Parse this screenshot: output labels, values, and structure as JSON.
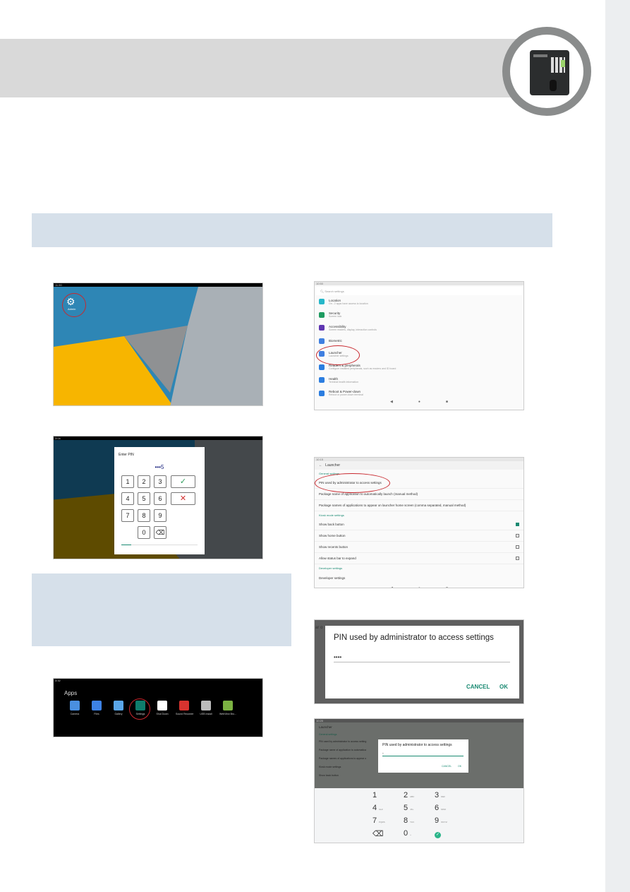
{
  "colors": {
    "header_band": "#d9d9d9",
    "info_band": "#d6e0ea",
    "ring": "#8a8c8c",
    "accent_green": "#1a8a72",
    "highlight_red": "#c8282e"
  },
  "desktop": {
    "time": "11:50",
    "icon_label": "Admin"
  },
  "pin_dialog": {
    "time": "3:04",
    "title": "Enter PIN",
    "value": "•••5",
    "keys": [
      "1",
      "2",
      "3",
      "4",
      "5",
      "6",
      "7",
      "8",
      "9",
      "0"
    ],
    "confirm_icon": "check-icon",
    "cancel_icon": "x-icon",
    "backspace_icon": "backspace-icon"
  },
  "apps": {
    "time": "3:32",
    "title": "Apps",
    "items": [
      {
        "label": "Camera",
        "color": "#4a8fe0"
      },
      {
        "label": "Files",
        "color": "#3d82e6"
      },
      {
        "label": "Gallery",
        "color": "#5aa6e8"
      },
      {
        "label": "Settings",
        "color": "#0f7d6c"
      },
      {
        "label": "Shut Down",
        "color": "#ffffff"
      },
      {
        "label": "Sound Recorder",
        "color": "#d8332f"
      },
      {
        "label": "USB Install",
        "color": "#bcbcbc"
      },
      {
        "label": "WebView Bro...",
        "color": "#7cb342"
      }
    ]
  },
  "settings": {
    "time": "10:50",
    "search_placeholder": "Search settings",
    "items": [
      {
        "title": "Location",
        "sub": "On - 2 apps have access to location",
        "color": "#26b7c9"
      },
      {
        "title": "Security",
        "sub": "Screen lock",
        "color": "#1e9c61"
      },
      {
        "title": "Accessibility",
        "sub": "Screen readers, display, interaction controls",
        "color": "#5e35b1"
      },
      {
        "title": "Biometric",
        "sub": "",
        "color": "#3f7fe0"
      },
      {
        "title": "Launcher",
        "sub": "Launcher settings",
        "color": "#3f7fe0"
      },
      {
        "title": "Readers & peripherals",
        "sub": "Configure installed peripherals, such as readers and ID board",
        "color": "#2b7de0"
      },
      {
        "title": "Health",
        "sub": "Terminal health information",
        "color": "#2b7de0"
      },
      {
        "title": "Reboot & Power-down",
        "sub": "Reboot or power-down terminal",
        "color": "#2b7de0"
      }
    ]
  },
  "launcher": {
    "time": "10:15",
    "title": "Launcher",
    "general_header": "General settings",
    "rows": [
      "PIN used by administrator to access settings",
      "Package name of application to automatically launch (manual method)",
      "Package names of applications to appear on launcher home screen (comma separated, manual method)"
    ],
    "kiosk_header": "Kiosk mode settings",
    "kiosk": [
      {
        "label": "Show back button",
        "checked": true
      },
      {
        "label": "Show home button",
        "checked": false
      },
      {
        "label": "Show recents button",
        "checked": false
      },
      {
        "label": "Allow status bar to expand",
        "checked": false
      }
    ],
    "developer_header": "Developer settings",
    "developer_row": "Developer settings"
  },
  "pin_edit": {
    "title": "PIN used by administrator to access settings",
    "value": "••••",
    "cancel": "CANCEL",
    "ok": "OK",
    "bg_text": "ar o"
  },
  "keyboard_screen": {
    "time": "10:20",
    "title": "Launcher",
    "bg_header": "General settings",
    "bg_rows": [
      "PIN used by administrator to access setting",
      "Package name of application to automatica",
      "Package names of applications to appear o",
      "Kiosk mode settings",
      "Show back button"
    ],
    "dialog_title": "PIN used by administrator to access settings",
    "value": "-",
    "cancel": "CANCEL",
    "ok": "OK",
    "keys": [
      {
        "n": "1",
        "l": ""
      },
      {
        "n": "2",
        "l": "ABC"
      },
      {
        "n": "3",
        "l": "DEF"
      },
      {
        "n": "4",
        "l": "GHI"
      },
      {
        "n": "5",
        "l": "JKL"
      },
      {
        "n": "6",
        "l": "MNO"
      },
      {
        "n": "7",
        "l": "PQRS"
      },
      {
        "n": "8",
        "l": "TUV"
      },
      {
        "n": "9",
        "l": "WXYZ"
      },
      {
        "n": "⌫",
        "l": ""
      },
      {
        "n": "0",
        "l": "+"
      },
      {
        "n": "✓",
        "l": ""
      }
    ]
  }
}
